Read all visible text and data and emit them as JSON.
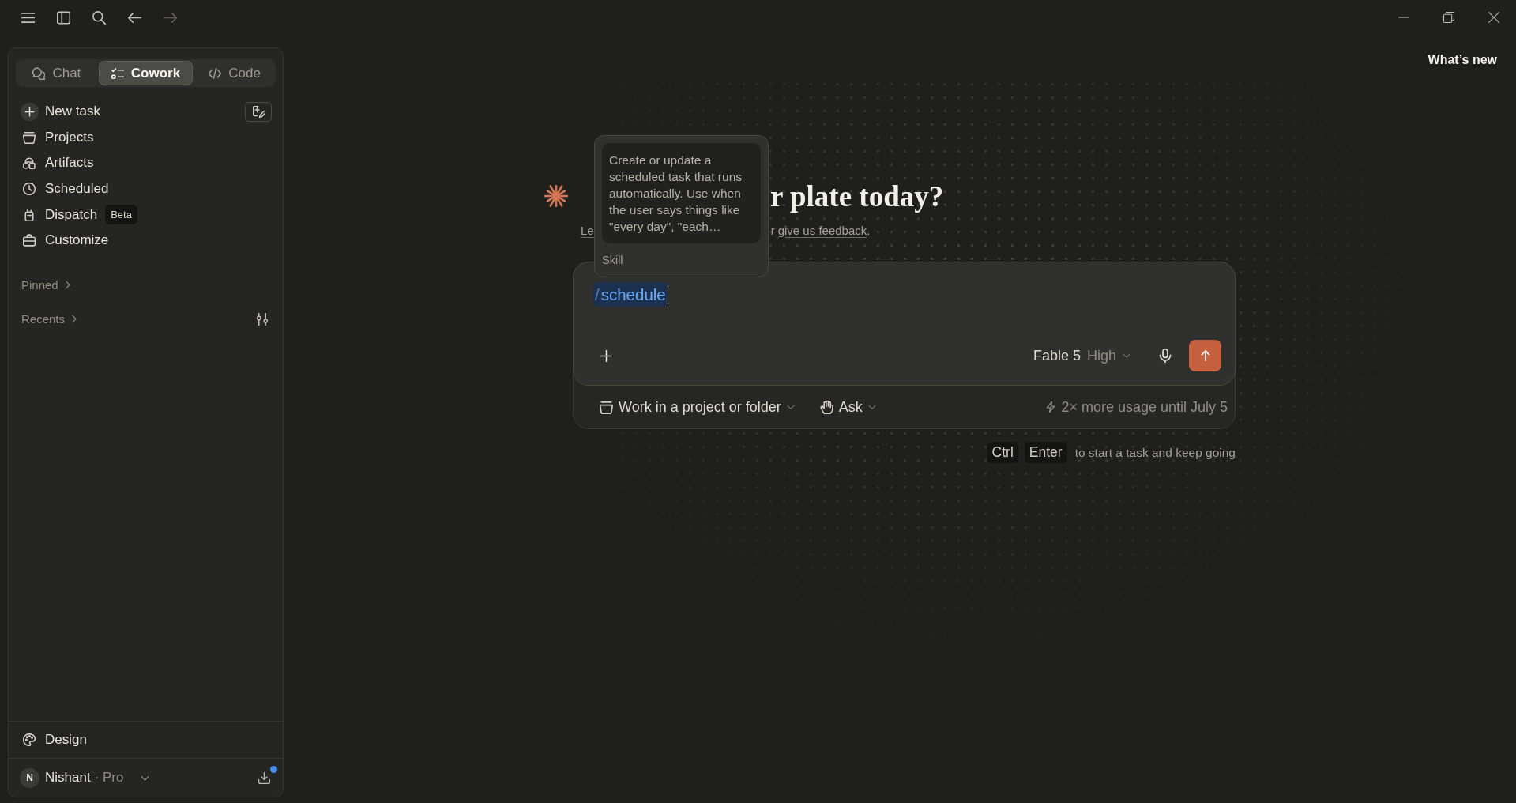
{
  "toolbar": {
    "back": {
      "disabled": false
    },
    "forward": {
      "disabled": true
    }
  },
  "sidebar": {
    "mode_tabs": [
      {
        "label": "Chat",
        "selected": false
      },
      {
        "label": "Cowork",
        "selected": true
      },
      {
        "label": "Code",
        "selected": false
      }
    ],
    "new_task": {
      "label": "New task"
    },
    "nav_items": [
      {
        "label": "Projects"
      },
      {
        "label": "Artifacts"
      },
      {
        "label": "Scheduled"
      },
      {
        "label": "Dispatch",
        "badge": "Beta"
      },
      {
        "label": "Customize"
      }
    ],
    "pinned": {
      "label": "Pinned"
    },
    "recents": {
      "label": "Recents"
    },
    "footer_item": {
      "label": "Design"
    },
    "account": {
      "initial": "N",
      "name": "Nishant",
      "plan": "· Pro",
      "update_available": true
    }
  },
  "header": {
    "whats_new": "What’s new"
  },
  "greeting": {
    "heading": "r plate today?",
    "subtitle_start": "Le",
    "subtitle_text": "r",
    "subtitle_link": "give us feedback",
    "subtitle_end": "."
  },
  "skill_popup": {
    "description": "Create or update a scheduled task that runs automatically. Use when the user says things like \"every day\", \"each…",
    "type": "Skill"
  },
  "composer": {
    "command_prefix": "/",
    "command": "schedule",
    "model": "Fable 5",
    "effort": "High",
    "project_picker": "Work in a project or folder",
    "mode": "Ask",
    "promo": "2× more usage until July 5"
  },
  "shortcut": {
    "keys": [
      "Ctrl",
      "Enter"
    ],
    "hint": "to start a task and keep going"
  }
}
